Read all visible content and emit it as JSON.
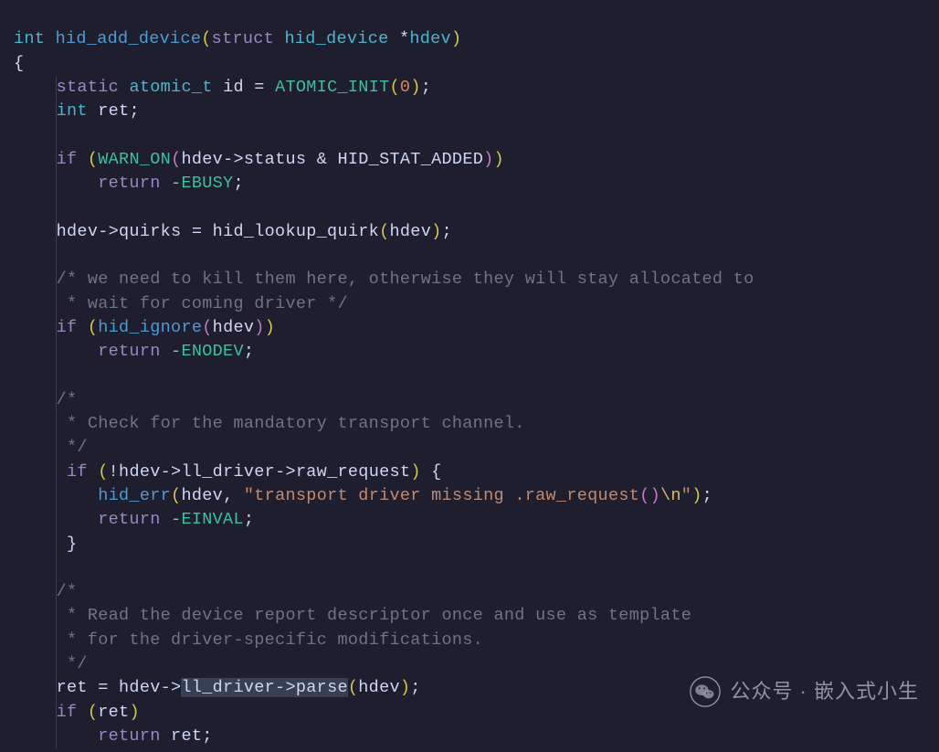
{
  "code": {
    "l1": {
      "ret_type": "int",
      "fname": "hid_add_device",
      "struct_kw": "struct",
      "param_type": "hid_device",
      "ptr": "*",
      "param": "hdev"
    },
    "l2": {
      "brace": "{"
    },
    "l3": {
      "kw_static": "static",
      "atomic": "atomic_t",
      "id": "id",
      "eq": "=",
      "init": "ATOMIC_INIT",
      "zero": "0",
      "tail": ";"
    },
    "l4": {
      "kw_int": "int",
      "ret": "ret",
      "semi": ";"
    },
    "l5": {
      "kw_if": "if",
      "warn": "WARN_ON",
      "mid": "hdev->status & HID_STAT_ADDED"
    },
    "l6": {
      "kw_return": "return",
      "neg": "-",
      "ebusy": "EBUSY",
      "semi": ";"
    },
    "l7": {
      "line": "hdev->quirks = hid_lookup_quirk",
      "arg": "hdev",
      "tail": ";"
    },
    "l8": {
      "c": "/* we need to kill them here, otherwise they will stay allocated to"
    },
    "l9": {
      "c": " * wait for coming driver */"
    },
    "l10": {
      "kw_if": "if",
      "fn": "hid_ignore",
      "arg": "hdev"
    },
    "l11": {
      "kw_return": "return",
      "neg": "-",
      "enodev": "ENODEV",
      "semi": ";"
    },
    "l12": {
      "c": "/*"
    },
    "l13": {
      "c": " * Check for the mandatory transport channel."
    },
    "l14": {
      "c": " */"
    },
    "l15": {
      "kw_if": "if",
      "bang": "!",
      "mid": "hdev->ll_driver->raw_request",
      "brace": "{"
    },
    "l16": {
      "fn": "hid_err",
      "arg1": "hdev",
      "comma": ",",
      "str_body": "\"transport driver missing .raw_request",
      "str_paren_open": "(",
      "str_paren_close": ")",
      "esc": "\\n",
      "str_end": "\"",
      "tail": ";"
    },
    "l17": {
      "kw_return": "return",
      "neg": "-",
      "einval": "EINVAL",
      "semi": ";"
    },
    "l18": {
      "brace": "}"
    },
    "l19": {
      "c": "/*"
    },
    "l20": {
      "c": " * Read the device report descriptor once and use as template"
    },
    "l21": {
      "c": " * for the driver-specific modifications."
    },
    "l22": {
      "c": " */"
    },
    "l23": {
      "lead": "ret = hdev->",
      "hl": "ll_driver->parse",
      "arg": "hdev",
      "tail": ";"
    },
    "l24": {
      "kw_if": "if",
      "arg": "ret"
    },
    "l25": {
      "kw_return": "return",
      "ret": "ret",
      "semi": ";"
    }
  },
  "watermark": {
    "text": "公众号 · 嵌入式小生"
  }
}
